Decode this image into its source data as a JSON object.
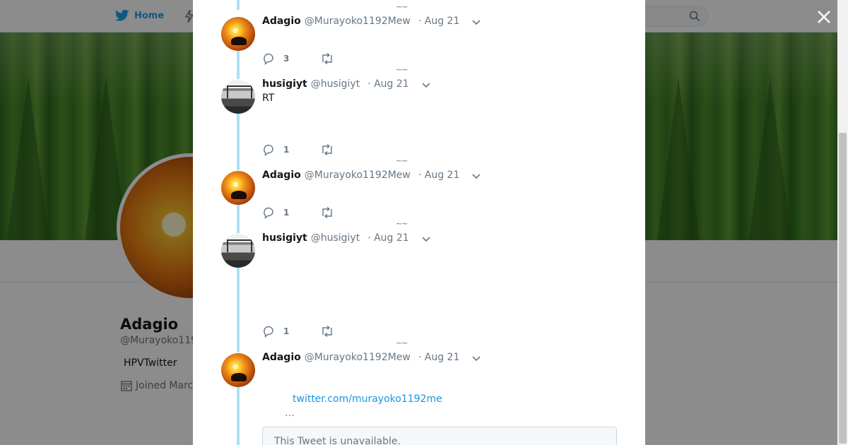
{
  "nav": {
    "home_label": "Home",
    "brand_color": "#1da1f2"
  },
  "profile": {
    "name": "Adagio",
    "handle": "@Murayoko119",
    "bio": "HPVTwitter",
    "joined": "Joined Marc"
  },
  "tweets": [
    {
      "name": "Adagio",
      "handle": "@Murayoko1192Mew",
      "time": "· Aug 21",
      "text": "",
      "replies": "3",
      "avatar": "sunset-birds"
    },
    {
      "name": "husigiyt",
      "handle": "@husigiyt",
      "time": "· Aug 21",
      "text": "RT",
      "replies": "1",
      "avatar": "street-gate"
    },
    {
      "name": "Adagio",
      "handle": "@Murayoko1192Mew",
      "time": "· Aug 21",
      "text": "",
      "replies": "1",
      "avatar": "sunset-birds"
    },
    {
      "name": "husigiyt",
      "handle": "@husigiyt",
      "time": "· Aug 21",
      "text": "",
      "replies": "1",
      "avatar": "street-gate"
    },
    {
      "name": "Adagio",
      "handle": "@Murayoko1192Mew",
      "time": "· Aug 21",
      "link": "twitter.com/murayoko1192me",
      "ellipsis": "…",
      "unavailable": "This Tweet is unavailable.",
      "avatar": "sunset-birds"
    }
  ],
  "separator": "~~"
}
